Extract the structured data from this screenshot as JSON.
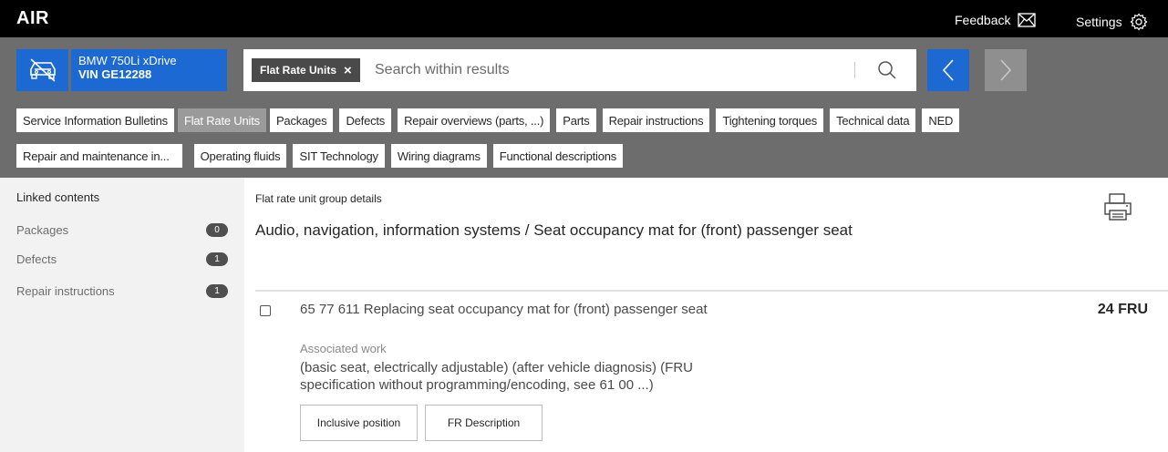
{
  "app": {
    "logo": "AIR"
  },
  "topbar": {
    "feedback_label": "Feedback",
    "settings_label": "Settings"
  },
  "vehicle": {
    "model": "BMW 750Li xDrive",
    "vin": "VIN GE12288",
    "icon": "car-icon"
  },
  "search": {
    "chip_label": "Flat Rate Units",
    "chip_close": "×",
    "placeholder": "Search within results",
    "value": ""
  },
  "tabs": {
    "row1": [
      {
        "label": "Service Information Bulletins",
        "active": false
      },
      {
        "label": "Flat Rate Units",
        "active": true
      },
      {
        "label": "Packages",
        "active": false
      },
      {
        "label": "Defects",
        "active": false
      },
      {
        "label": "Repair overviews (parts, ...)",
        "active": false
      },
      {
        "label": "Parts",
        "active": false
      },
      {
        "label": "Repair instructions",
        "active": false
      },
      {
        "label": "Tightening torques",
        "active": false
      },
      {
        "label": "Technical data",
        "active": false
      },
      {
        "label": "NED",
        "active": false
      }
    ],
    "row2": [
      {
        "label": "Repair and maintenance in...",
        "active": false
      },
      {
        "label": "Operating fluids",
        "active": false
      },
      {
        "label": "SIT Technology",
        "active": false
      },
      {
        "label": "Wiring diagrams",
        "active": false
      },
      {
        "label": "Functional descriptions",
        "active": false
      }
    ]
  },
  "sidebar": {
    "title": "Linked contents",
    "items": [
      {
        "label": "Packages",
        "count": "0"
      },
      {
        "label": "Defects",
        "count": "1"
      },
      {
        "label": "Repair instructions",
        "count": "1"
      }
    ]
  },
  "main": {
    "group_label": "Flat rate unit group details",
    "group_title": "Audio, navigation, information systems / Seat occupancy mat for (front) passenger seat",
    "row": {
      "title": "65 77 611 Replacing seat occupancy mat for (front) passenger seat",
      "fru": "24 FRU",
      "assoc_label": "Associated work",
      "assoc_text": "(basic seat, electrically adjustable) (after vehicle diagnosis) (FRU specification without programming/encoding, see 61 00 ...)",
      "inclusive_label": "Inclusive position",
      "fr_description_label": "FR Description"
    }
  },
  "colors": {
    "accent": "#1c69d4",
    "header_bg": "#6d6d6d",
    "topbar_bg": "#000000",
    "sidebar_bg": "#f2f2f2"
  }
}
